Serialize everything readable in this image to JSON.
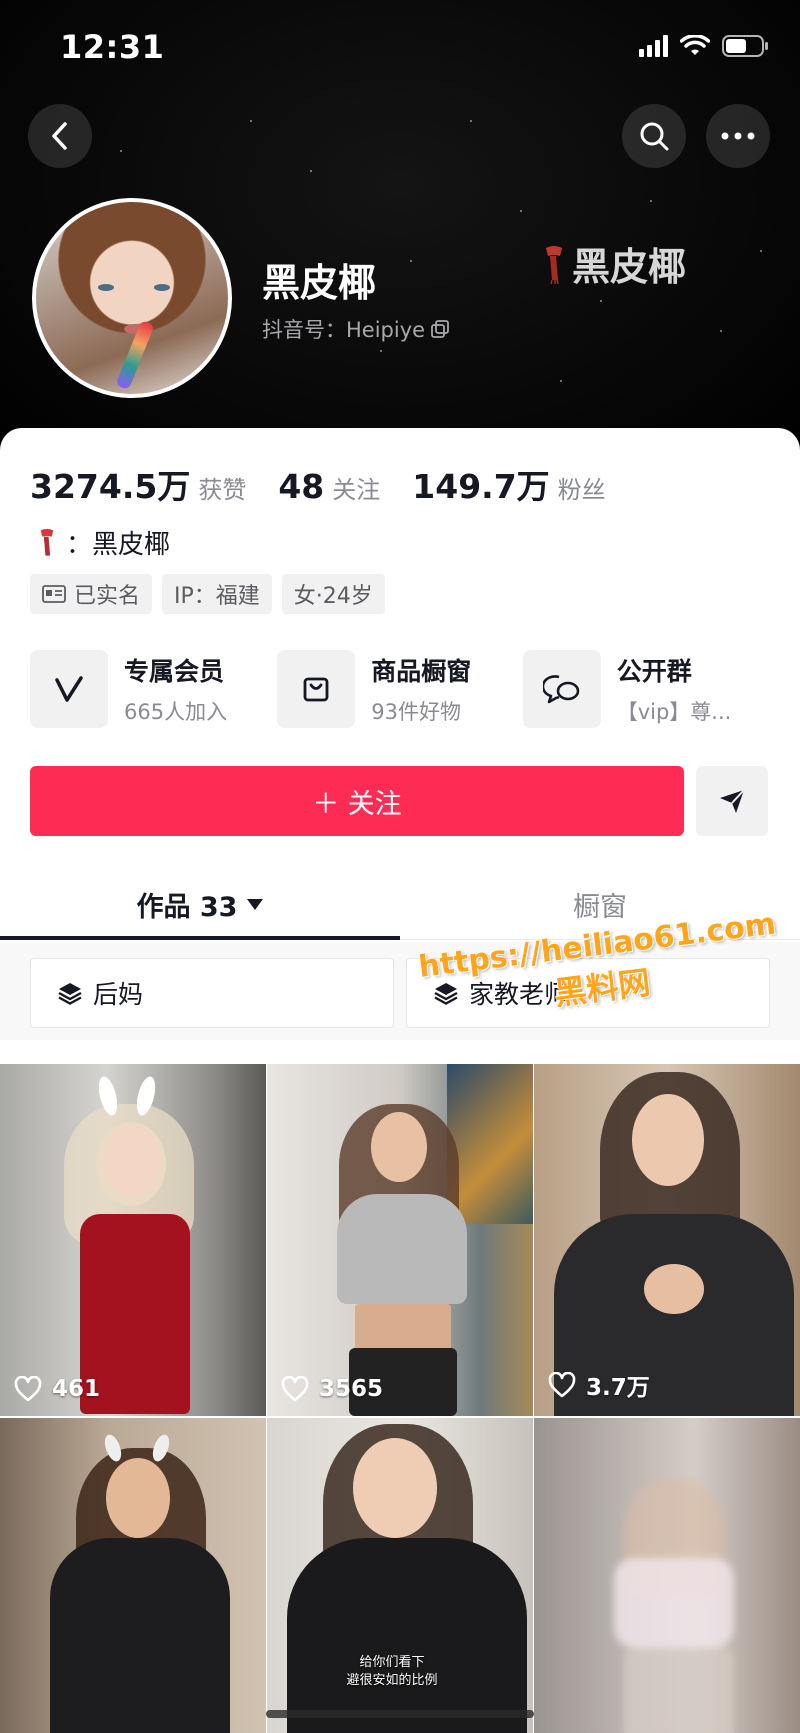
{
  "status_bar": {
    "time": "12:31"
  },
  "profile": {
    "username": "黑皮椰",
    "handle": "抖音号：Heipiye",
    "corner_tag": "黑皮椰"
  },
  "stats": [
    {
      "value": "3274.5万",
      "label": "获赞"
    },
    {
      "value": "48",
      "label": "关注"
    },
    {
      "value": "149.7万",
      "label": "粉丝"
    }
  ],
  "bio": {
    "text": "：黑皮椰"
  },
  "tags": [
    {
      "label": "已实名",
      "icon": "id-card-icon"
    },
    {
      "label": "IP：福建"
    },
    {
      "label": "女·24岁"
    }
  ],
  "features": [
    {
      "title": "专属会员",
      "subtitle": "665人加入",
      "icon": "vip-v-icon"
    },
    {
      "title": "商品橱窗",
      "subtitle": "93件好物",
      "icon": "shopping-bag-icon"
    },
    {
      "title": "公开群",
      "subtitle": "【vip】尊...",
      "icon": "group-chat-icon"
    }
  ],
  "actions": {
    "follow_label": "＋ 关注"
  },
  "tabs": [
    {
      "label": "作品 33",
      "active": true
    },
    {
      "label": "橱窗",
      "active": false
    }
  ],
  "collections": [
    {
      "label": "后妈"
    },
    {
      "label": "家教老师"
    }
  ],
  "videos": [
    {
      "likes": "461"
    },
    {
      "likes": "3565"
    },
    {
      "likes": "3.7万"
    },
    {
      "likes": ""
    },
    {
      "likes": "",
      "caption_1": "给你们看下",
      "caption_2": "避很安如的比例"
    },
    {
      "likes": ""
    }
  ],
  "watermark": {
    "url": "https://heiliao61.com",
    "name": "黑料网"
  },
  "colors": {
    "accent": "#fe2c55",
    "watermark": "#ffa51a",
    "header_bg": "#000000"
  }
}
